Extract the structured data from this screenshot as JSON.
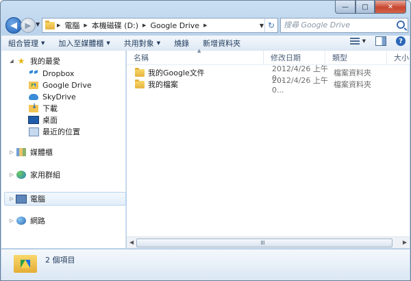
{
  "address": {
    "crumbs": [
      "電腦",
      "本機磁碟 (D:)",
      "Google Drive"
    ]
  },
  "search": {
    "placeholder": "搜尋 Google Drive"
  },
  "toolbar": {
    "organize": "組合管理",
    "include_in_library": "加入至媒體櫃",
    "share_with": "共用對象",
    "burn": "燒錄",
    "new_folder": "新增資料夾"
  },
  "nav": {
    "favorites": "我的最愛",
    "favorite_items": [
      "Dropbox",
      "Google Drive",
      "SkyDrive",
      "下載",
      "桌面",
      "最近的位置"
    ],
    "libraries": "媒體櫃",
    "homegroup": "家用群組",
    "computer": "電腦",
    "network": "網路"
  },
  "columns": {
    "name": "名稱",
    "date": "修改日期",
    "type": "類型",
    "size": "大小"
  },
  "files": [
    {
      "name": "我的Google文件",
      "date": "2012/4/26 上午 0...",
      "type": "檔案資料夾"
    },
    {
      "name": "我的檔案",
      "date": "2012/4/26 上午 0...",
      "type": "檔案資料夾"
    }
  ],
  "status": {
    "item_count": "2 個項目"
  },
  "caption": {
    "minimize": "—",
    "maximize": "□",
    "close": "✕"
  }
}
